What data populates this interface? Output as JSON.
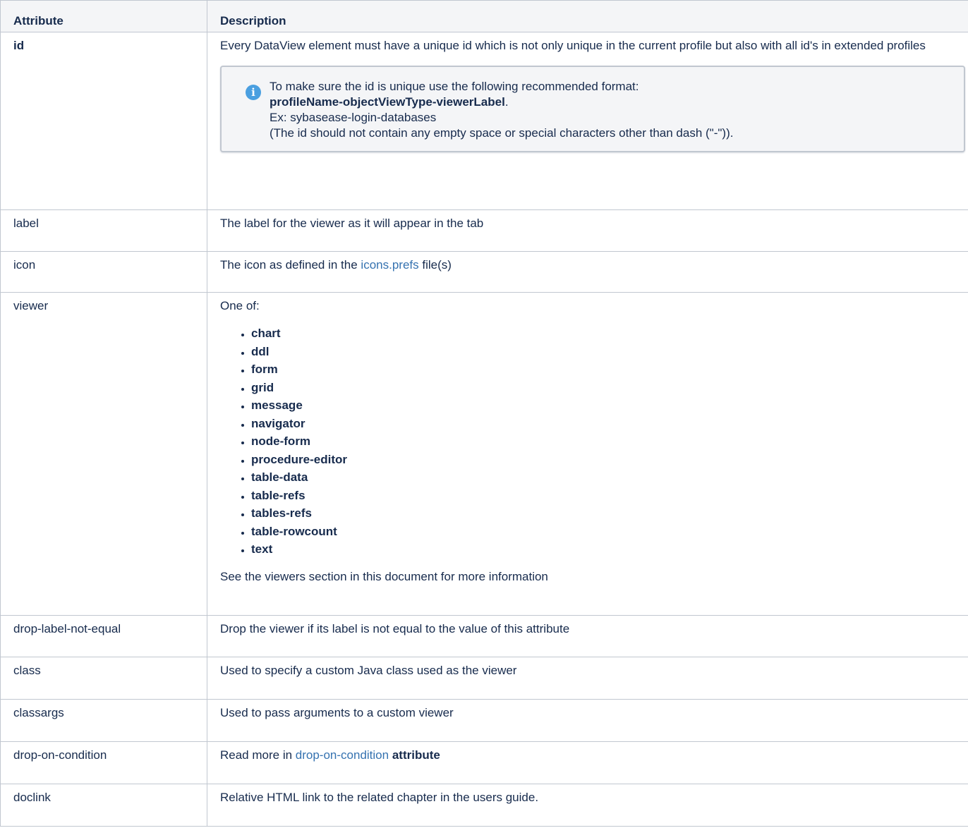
{
  "table": {
    "headers": {
      "attribute": "Attribute",
      "description": "Description"
    },
    "rows": {
      "id": {
        "name": "id",
        "desc": "Every DataView element must have a unique id which is not only unique in the current profile but also with all id's in extended profiles",
        "info": {
          "line1": "To make sure the id is unique use the following recommended format:",
          "format_bold": "profileName-objectViewType-viewerLabel",
          "format_suffix": ".",
          "example": "Ex: sybasease-login-databases",
          "note": "(The id should not contain any empty space or special characters other than dash (\"-\"))."
        }
      },
      "label": {
        "name": "label",
        "desc": "The label for the viewer as it will appear in the tab"
      },
      "icon": {
        "name": "icon",
        "desc_prefix": "The icon as defined in the ",
        "desc_link": "icons.prefs",
        "desc_suffix": " file(s)"
      },
      "viewer": {
        "name": "viewer",
        "intro": "One of:",
        "options": [
          "chart",
          "ddl",
          "form",
          "grid",
          "message",
          "navigator",
          "node-form",
          "procedure-editor",
          "table-data",
          "table-refs",
          "tables-refs",
          "table-rowcount",
          "text"
        ],
        "footer": "See the viewers section in this document for more information"
      },
      "drop_label": {
        "name": "drop-label-not-equal",
        "desc": "Drop the viewer if its label is not equal to the value of this attribute"
      },
      "class": {
        "name": "class",
        "desc": "Used to specify a custom Java class used as the viewer"
      },
      "classargs": {
        "name": "classargs",
        "desc": "Used to pass arguments to a custom viewer"
      },
      "drop_on_condition": {
        "name": "drop-on-condition",
        "desc_prefix": "Read more in ",
        "desc_link": "drop-on-condition",
        "desc_bold": "attribute"
      },
      "doclink": {
        "name": "doclink",
        "desc": "Relative HTML link to the related chapter in the users guide."
      }
    }
  },
  "colors": {
    "link": "#3572b0",
    "info_icon": "#4a9fe0",
    "header_bg": "#f4f5f7",
    "border": "#c1c7d0"
  },
  "icons": {
    "info": "info-icon"
  }
}
